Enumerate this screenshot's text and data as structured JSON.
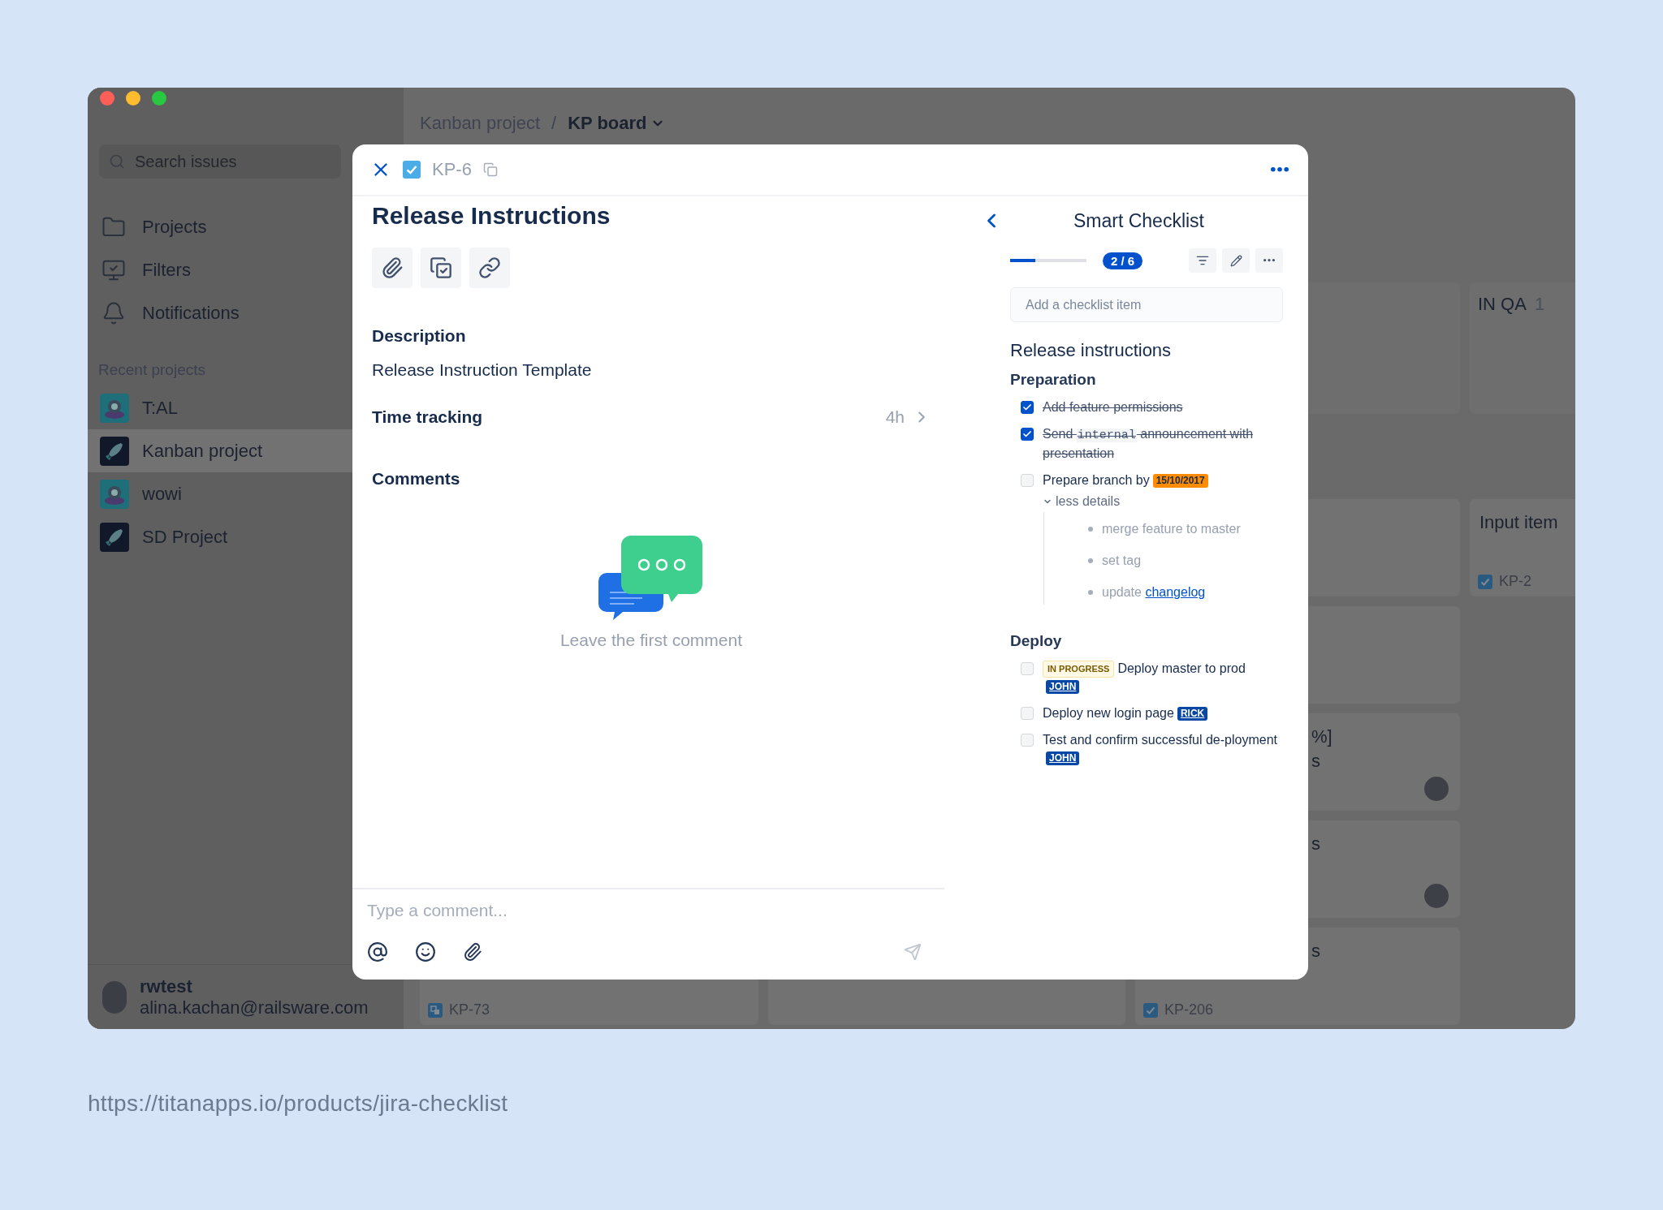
{
  "sidebar": {
    "search": {
      "placeholder": "Search issues"
    },
    "nav": [
      {
        "label": "Projects"
      },
      {
        "label": "Filters"
      },
      {
        "label": "Notifications"
      }
    ],
    "recent_title": "Recent projects",
    "projects": [
      {
        "name": "T:AL",
        "selected": false
      },
      {
        "name": "Kanban project",
        "selected": true
      },
      {
        "name": "wowi",
        "selected": false
      },
      {
        "name": "SD Project",
        "selected": false
      }
    ],
    "user": {
      "name": "rwtest",
      "email": "alina.kachan@railsware.com"
    }
  },
  "board": {
    "breadcrumb": [
      {
        "label": "Kanban project",
        "current": false
      },
      {
        "separator": "/",
        "label": "KP board",
        "current": true
      }
    ],
    "columns": [
      {
        "cards": [
          {
            "kind": "issue",
            "key": "KP-73"
          }
        ]
      },
      {
        "cards": [
          {
            "kind": "empty"
          }
        ]
      },
      {
        "cards": [
          {
            "kind": "empty"
          },
          {
            "kind": "empty"
          },
          {
            "kind": "partial",
            "lines": [
              "%]",
              "s"
            ],
            "avatar": true
          },
          {
            "kind": "partial",
            "lines": [
              "s"
            ],
            "avatar": true
          },
          {
            "kind": "partial",
            "lines": [
              "s"
            ],
            "key": "KP-206"
          }
        ]
      },
      {
        "title": "IN QA",
        "count": "1",
        "cards": [
          {
            "kind": "issue",
            "lines": [
              "Input item"
            ],
            "key": "KP-2"
          }
        ]
      }
    ]
  },
  "issue": {
    "key": "KP-6",
    "title": "Release Instructions",
    "description_label": "Description",
    "description": "Release Instruction Template",
    "time_tracking": {
      "label": "Time tracking",
      "value": "4h"
    },
    "comments_label": "Comments",
    "empty_comments": "Leave the first comment",
    "comment_placeholder": "Type a comment..."
  },
  "checklist": {
    "title": "Smart Checklist",
    "progress": {
      "level": 0.333,
      "label": "2 / 6"
    },
    "add_placeholder": "Add a checklist item",
    "heading": "Release instructions",
    "sections": [
      {
        "title": "Preparation",
        "items": [
          {
            "checked": true,
            "segments": [
              {
                "kind": "text",
                "text": "Add feature permissions"
              }
            ]
          },
          {
            "checked": true,
            "segments": [
              {
                "kind": "text",
                "text": "Send "
              },
              {
                "kind": "code",
                "text": "internal"
              },
              {
                "kind": "text",
                "text": " announcement with presentation"
              }
            ]
          },
          {
            "checked": false,
            "segments": [
              {
                "kind": "text",
                "text": "Prepare branch by "
              },
              {
                "kind": "date",
                "text": "15/10/2017"
              }
            ],
            "details": {
              "toggle": "less details",
              "expanded": true,
              "items": [
                {
                  "segments": [
                    {
                      "kind": "text",
                      "text": "merge feature to master"
                    }
                  ]
                },
                {
                  "segments": [
                    {
                      "kind": "text",
                      "text": "set tag"
                    }
                  ]
                },
                {
                  "segments": [
                    {
                      "kind": "text",
                      "text": "update "
                    },
                    {
                      "kind": "link",
                      "text": "changelog"
                    }
                  ]
                }
              ]
            }
          }
        ]
      },
      {
        "title": "Deploy",
        "items": [
          {
            "checked": false,
            "segments": [
              {
                "kind": "status",
                "text": "IN PROGRESS"
              },
              {
                "kind": "text",
                "text": "Deploy master to prod"
              },
              {
                "kind": "mention",
                "text": "JOHN"
              }
            ]
          },
          {
            "checked": false,
            "segments": [
              {
                "kind": "text",
                "text": "Deploy new login page"
              },
              {
                "kind": "mention",
                "text": "RICK"
              }
            ]
          },
          {
            "checked": false,
            "segments": [
              {
                "kind": "text",
                "text": "Test and confirm successful de-ployment"
              },
              {
                "kind": "mention",
                "text": "JOHN"
              }
            ]
          }
        ]
      }
    ]
  },
  "caption": "https://titanapps.io/products/jira-checklist"
}
